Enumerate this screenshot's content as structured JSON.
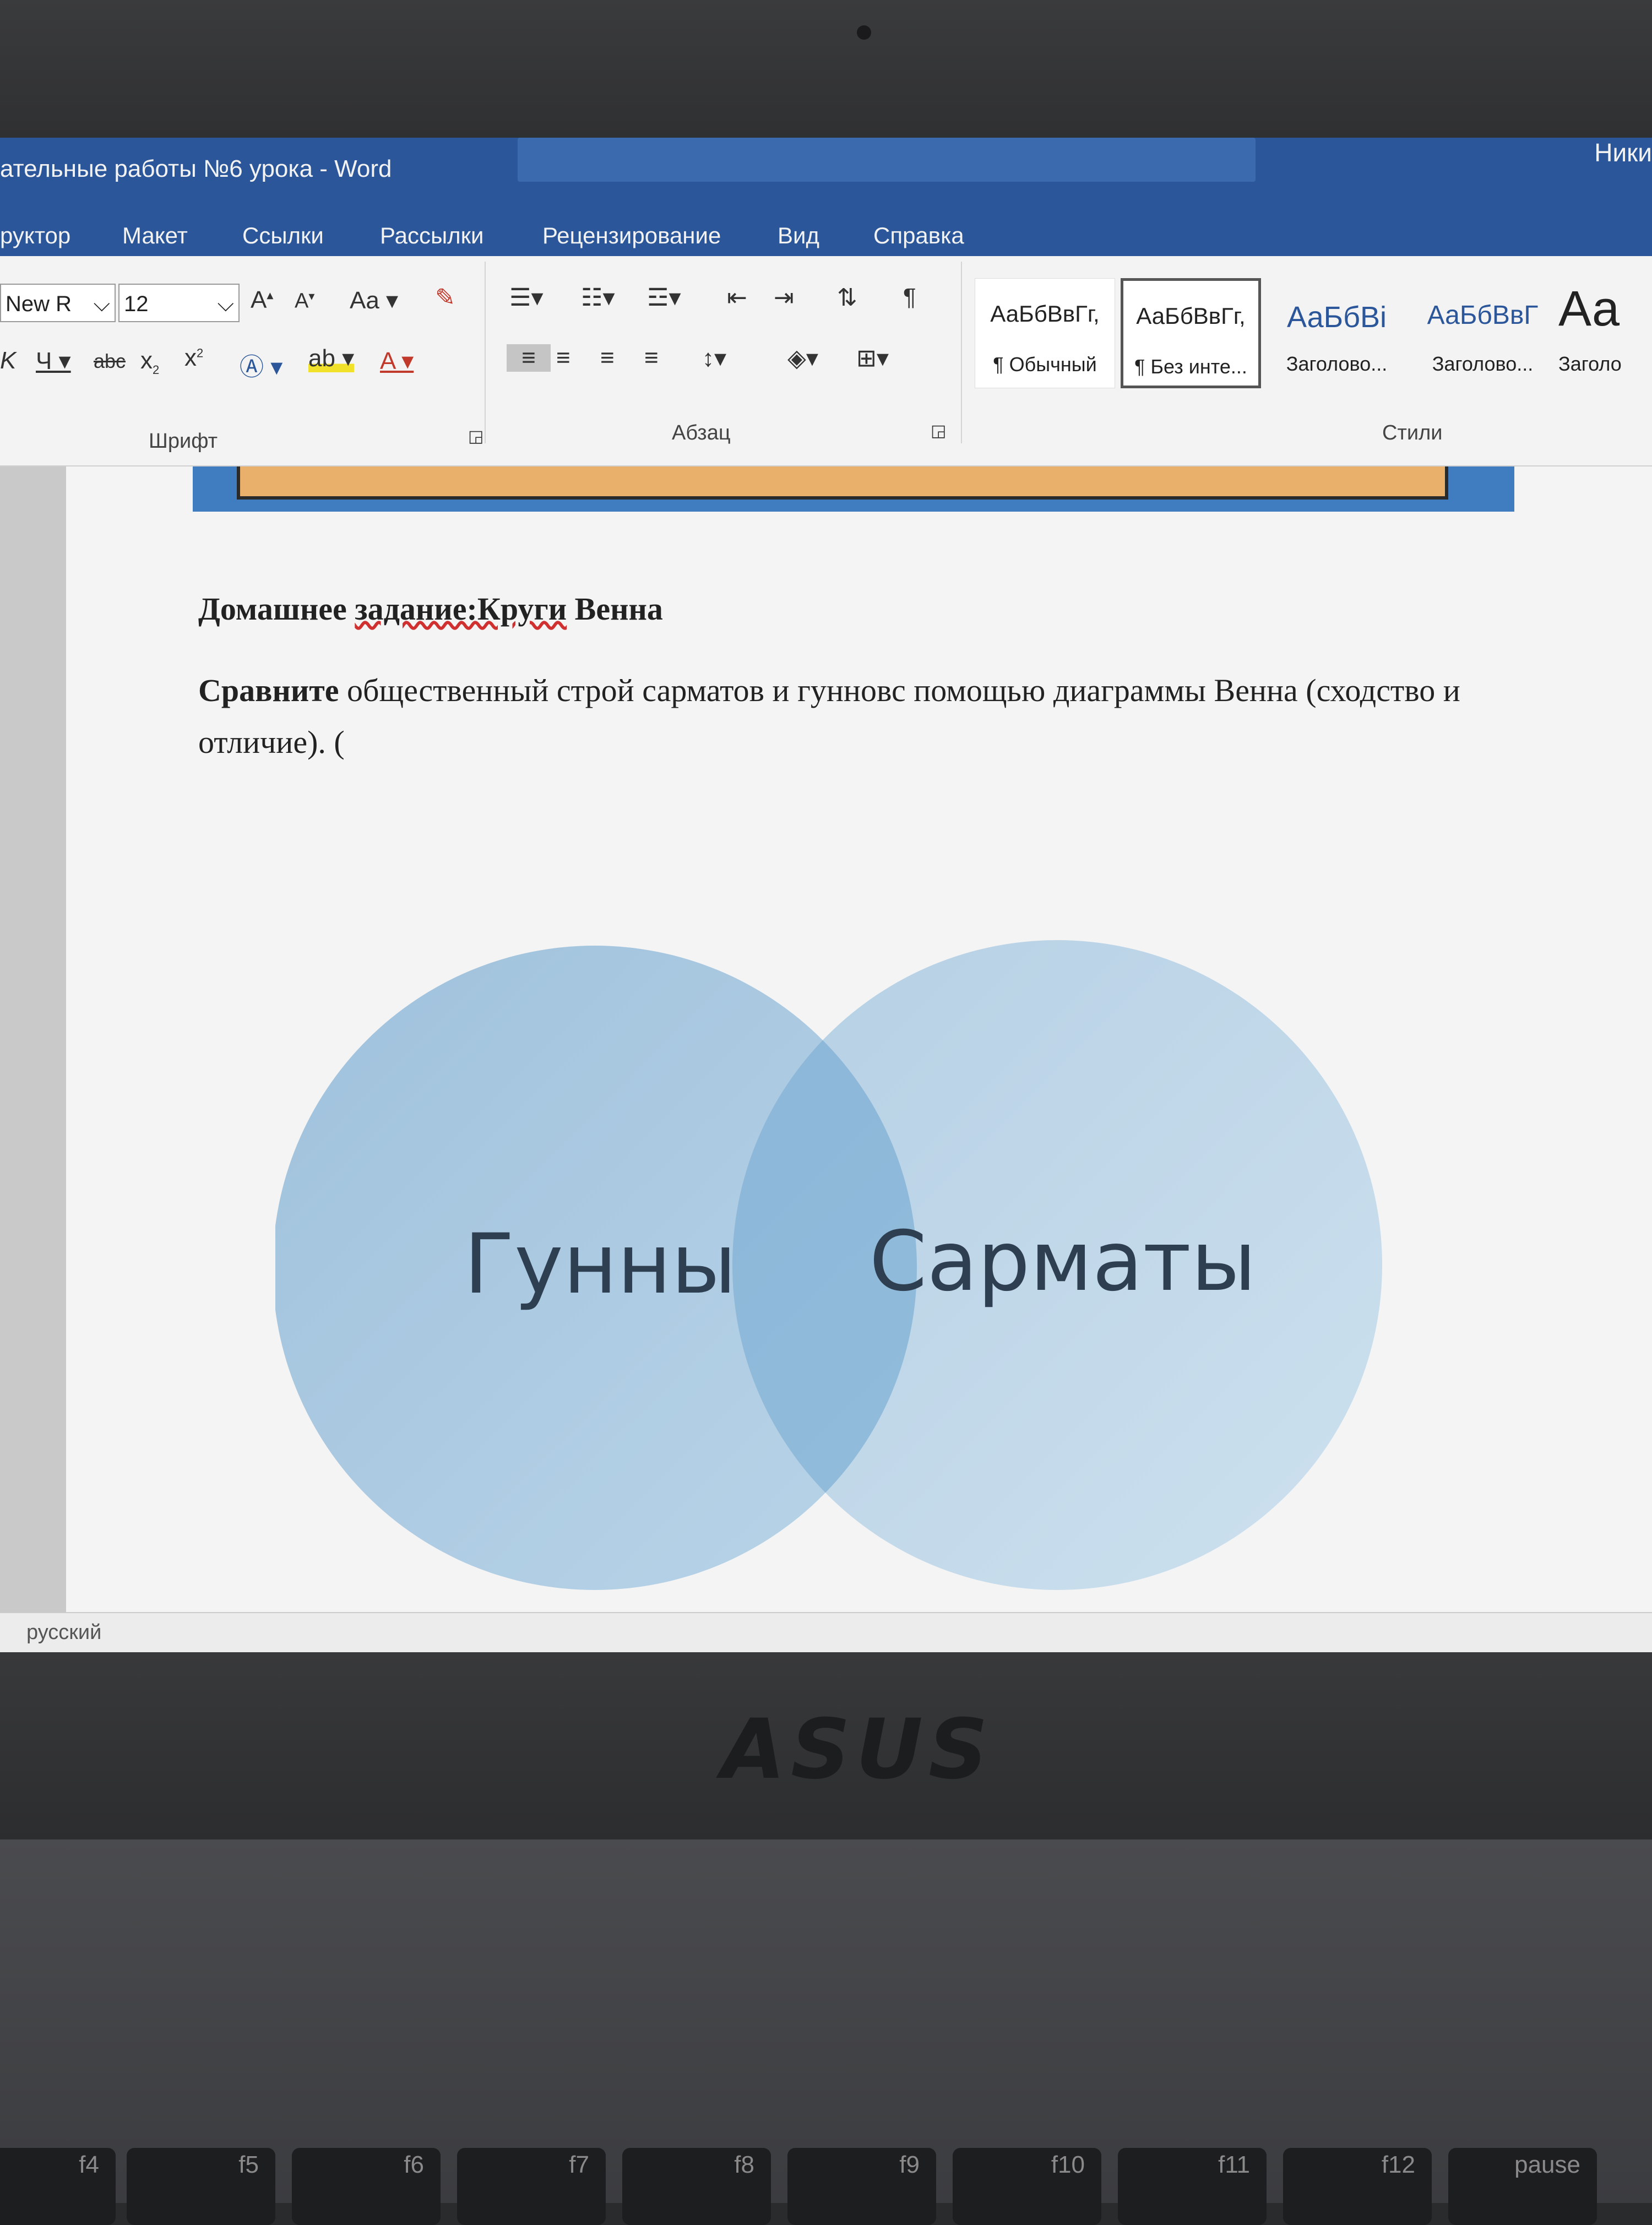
{
  "window": {
    "title": "ательные работы №6 урока  -  Word",
    "user": "Ники"
  },
  "tabs": [
    "руктор",
    "Макет",
    "Ссылки",
    "Рассылки",
    "Рецензирование",
    "Вид",
    "Справка"
  ],
  "ribbon": {
    "font_name": "New R",
    "font_size": "12",
    "case_btn": "Aa",
    "group_font": "Шрифт",
    "group_paragraph": "Абзац",
    "group_styles": "Стили",
    "styles": [
      {
        "preview": "АаБбВвГг,",
        "name": "¶ Обычный"
      },
      {
        "preview": "АаБбВвГг,",
        "name": "¶ Без инте..."
      },
      {
        "preview": "АаБбВі",
        "name": "Заголово..."
      },
      {
        "preview": "АаБбВвГ",
        "name": "Заголово..."
      },
      {
        "preview": "Аа",
        "name": "Заголо"
      }
    ]
  },
  "document": {
    "heading_prefix": "Домашнее ",
    "heading_word": "задание:Круги",
    "heading_suffix": " Венна",
    "task_bold": "Сравните",
    "task_text": " общественный строй сарматов и гунновс помощью диаграммы Венна (сходство и отличие).  (",
    "venn_left": "Гунны",
    "venn_right": "Сарматы"
  },
  "status": {
    "language": "русский"
  },
  "hardware": {
    "brand": "ASUS",
    "fkeys": [
      "f4",
      "f5",
      "f6",
      "f7",
      "f8",
      "f9",
      "f10",
      "f11",
      "f12",
      "pause"
    ]
  },
  "colors": {
    "word_blue": "#2b579a",
    "venn_circle": "#a9c8e0",
    "venn_overlap": "#7faed3"
  }
}
